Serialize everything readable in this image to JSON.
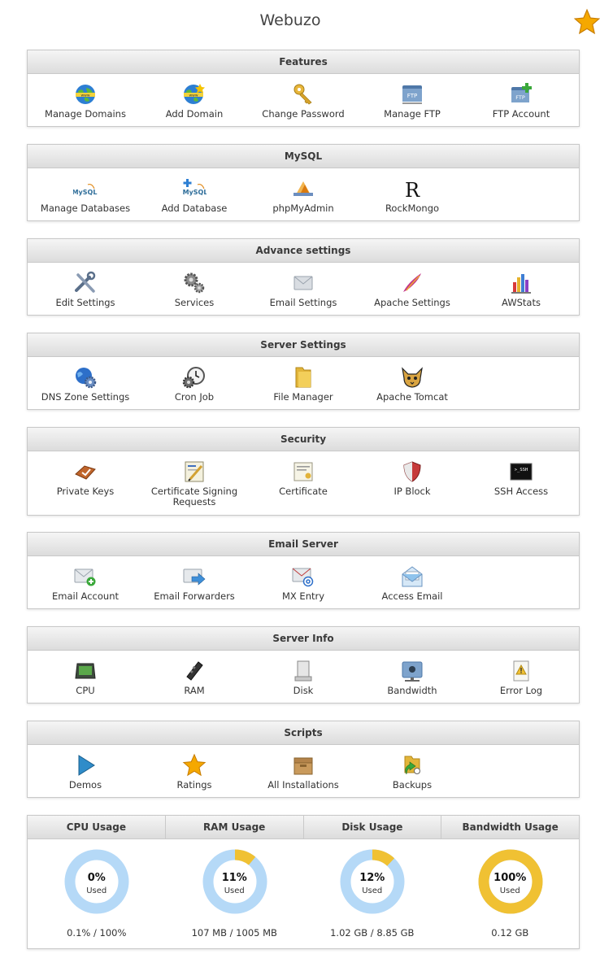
{
  "app": {
    "title": "Webuzo"
  },
  "sections": {
    "features": {
      "title": "Features",
      "items": [
        "Manage Domains",
        "Add Domain",
        "Change Password",
        "Manage FTP",
        "FTP Account"
      ]
    },
    "mysql": {
      "title": "MySQL",
      "items": [
        "Manage Databases",
        "Add Database",
        "phpMyAdmin",
        "RockMongo"
      ]
    },
    "advance": {
      "title": "Advance settings",
      "items": [
        "Edit Settings",
        "Services",
        "Email Settings",
        "Apache Settings",
        "AWStats"
      ]
    },
    "server": {
      "title": "Server Settings",
      "items": [
        "DNS Zone Settings",
        "Cron Job",
        "File Manager",
        "Apache Tomcat"
      ]
    },
    "security": {
      "title": "Security",
      "items": [
        "Private Keys",
        "Certificate Signing Requests",
        "Certificate",
        "IP Block",
        "SSH Access"
      ]
    },
    "email": {
      "title": "Email Server",
      "items": [
        "Email Account",
        "Email Forwarders",
        "MX Entry",
        "Access Email"
      ]
    },
    "info": {
      "title": "Server Info",
      "items": [
        "CPU",
        "RAM",
        "Disk",
        "Bandwidth",
        "Error Log"
      ]
    },
    "scripts": {
      "title": "Scripts",
      "items": [
        "Demos",
        "Ratings",
        "All Installations",
        "Backups"
      ]
    }
  },
  "icon_text": {
    "mysql": "MySQL",
    "ftp": "FTP",
    "rock": "R",
    "ssh": ">_SSH"
  },
  "usage": [
    {
      "title": "CPU Usage",
      "percent": 0,
      "label": "0%",
      "used": "Used",
      "detail": "0.1% / 100%"
    },
    {
      "title": "RAM Usage",
      "percent": 11,
      "label": "11%",
      "used": "Used",
      "detail": "107 MB / 1005 MB"
    },
    {
      "title": "Disk Usage",
      "percent": 12,
      "label": "12%",
      "used": "Used",
      "detail": "1.02 GB / 8.85 GB"
    },
    {
      "title": "Bandwidth Usage",
      "percent": 100,
      "label": "100%",
      "used": "Used",
      "detail": "0.12 GB"
    }
  ],
  "colors": {
    "gauge_track": "#b5d9f7",
    "gauge_fill": "#f0c133"
  }
}
